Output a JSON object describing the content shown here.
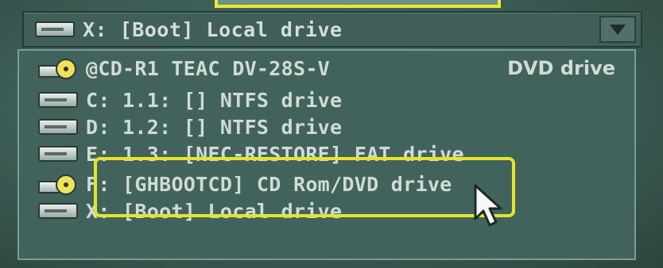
{
  "top_select": {
    "label": "X: [Boot] Local drive",
    "icon": "hard-drive-icon"
  },
  "drives": [
    {
      "label": "@CD-R1 TEAC   DV-28S-V",
      "type": "DVD drive",
      "icon": "cd-drive-icon"
    },
    {
      "label": "C: 1.1: [] NTFS drive",
      "icon": "hard-drive-icon"
    },
    {
      "label": "D: 1.2: [] NTFS drive",
      "icon": "hard-drive-icon"
    },
    {
      "label": "E: 1.3: [NEC-RESTORE] FAT drive",
      "icon": "hard-drive-icon"
    },
    {
      "label": "F: [GHBOOTCD] CD Rom/DVD drive",
      "icon": "cd-drive-icon"
    },
    {
      "label": "X: [Boot] Local drive",
      "icon": "hard-drive-icon"
    }
  ],
  "colors": {
    "highlight": "#e3e52c",
    "panel": "#42635b",
    "text": "#d0dbd7"
  }
}
